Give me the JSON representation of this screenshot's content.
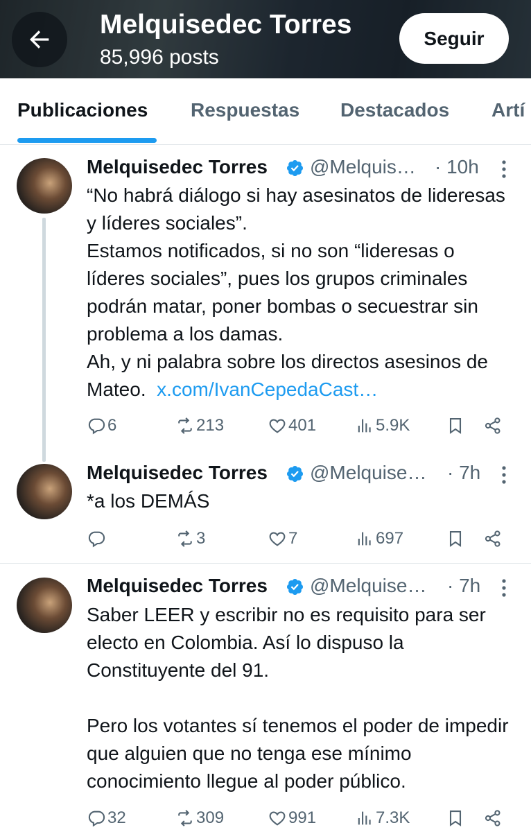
{
  "header": {
    "name": "Melquisedec Torres",
    "posts": "85,996 posts",
    "follow_label": "Seguir"
  },
  "tabs": [
    "Publicaciones",
    "Respuestas",
    "Destacados",
    "Artí"
  ],
  "tweets": [
    {
      "author": "Melquisedec Torres",
      "handle": "@Melquis…",
      "time": "· 10h",
      "text": "“No habrá diálogo si hay asesinatos de lideresas y líderes sociales”.\nEstamos notificados, si no son “lideresas o líderes sociales”, pues los grupos criminales podrán matar, poner bombas o secuestrar sin problema a los damas.\nAh, y ni palabra sobre los directos asesinos de Mateo.",
      "link": "x.com/IvanCepedaCast…",
      "replies": "6",
      "reposts": "213",
      "likes": "401",
      "views": "5.9K"
    },
    {
      "author": "Melquisedec Torres",
      "handle": "@Melquise…",
      "time": "· 7h",
      "text": "*a los DEMÁS",
      "replies": "",
      "reposts": "3",
      "likes": "7",
      "views": "697"
    },
    {
      "author": "Melquisedec Torres",
      "handle": "@Melquise…",
      "time": "· 7h",
      "text": "Saber LEER y escribir no es requisito para ser electo en Colombia. Así lo dispuso la Constituyente del 91.\n\nPero los votantes sí tenemos el poder de impedir que alguien que no tenga ese mínimo conocimiento llegue al poder público.",
      "replies": "32",
      "reposts": "309",
      "likes": "991",
      "views": "7.3K"
    }
  ],
  "colors": {
    "accent": "#1d9bf0",
    "verified": "#1d9bf0",
    "secondary_text": "#536471"
  }
}
